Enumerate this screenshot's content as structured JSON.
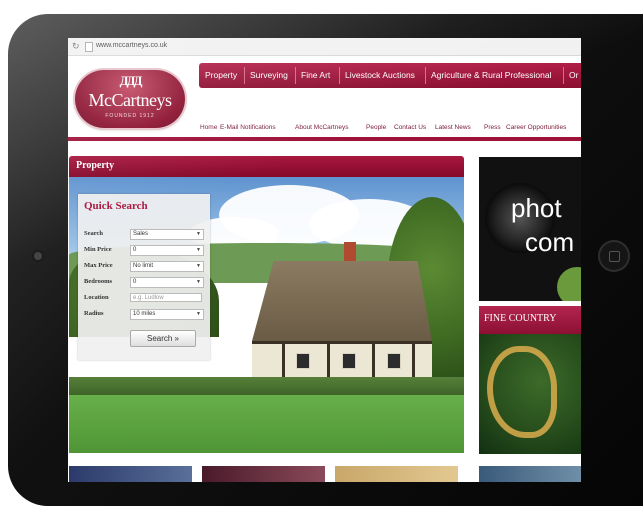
{
  "browser": {
    "url": "www.mccartneys.co.uk"
  },
  "logo": {
    "name": "McCartneys",
    "tagline": "FOUNDED 1912"
  },
  "main_nav": [
    "Property",
    "Surveying",
    "Fine Art",
    "Livestock Auctions",
    "Agriculture & Rural Professional",
    "Or"
  ],
  "sub_nav": [
    "Home",
    "E-Mail Notifications",
    "About McCartneys",
    "People",
    "Contact Us",
    "Latest News",
    "Press",
    "Career Opportunities"
  ],
  "section_title": "Property",
  "quick_search": {
    "title": "Quick Search",
    "fields": [
      {
        "label": "Search",
        "value": "Sales",
        "kind": "select"
      },
      {
        "label": "Min Price",
        "value": "0",
        "kind": "select"
      },
      {
        "label": "Max Price",
        "value": "No limit",
        "kind": "select"
      },
      {
        "label": "Bedrooms",
        "value": "0",
        "kind": "select"
      },
      {
        "label": "Location",
        "placeholder": "e.g. Ludlow",
        "kind": "input"
      },
      {
        "label": "Radius",
        "value": "10 miles",
        "kind": "select"
      }
    ],
    "button": "Search »"
  },
  "promos": [
    {
      "text_line1": "phot",
      "text_line2": "com"
    },
    {
      "title": "FINE COUNTRY"
    }
  ],
  "colors": {
    "brand": "#9e1238",
    "nav_text": "#ffffff",
    "link": "#7a1a35"
  }
}
